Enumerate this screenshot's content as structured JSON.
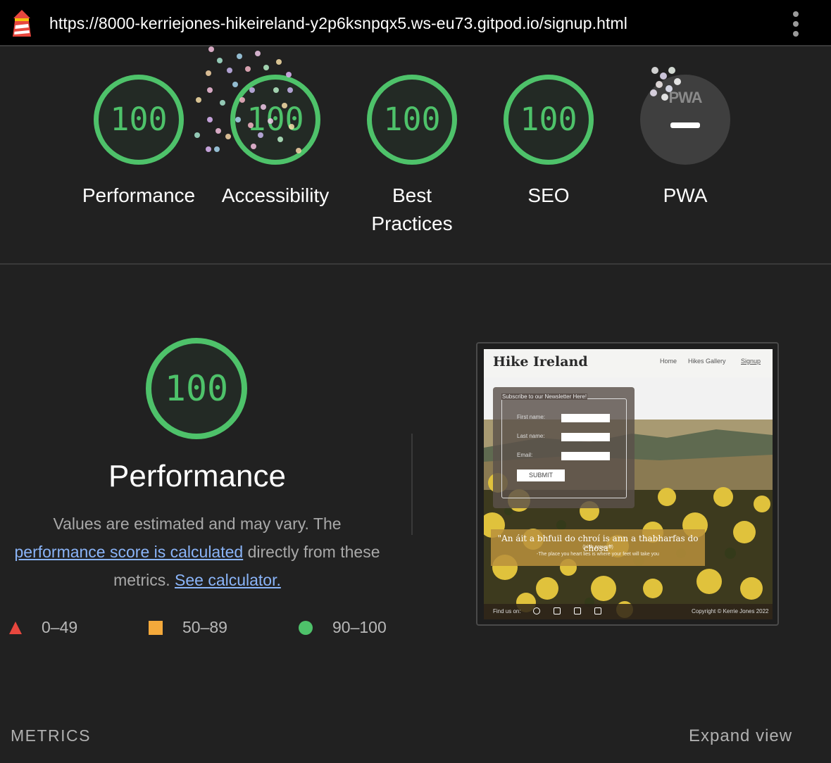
{
  "browser": {
    "url": "https://8000-kerriejones-hikeireland-y2p6ksnpqx5.ws-eu73.gitpod.io/signup.html",
    "logo_icon": "lighthouse-icon",
    "menu_icon": "kebab-menu-icon"
  },
  "categories": [
    {
      "label": "Performance",
      "score": "100"
    },
    {
      "label": "Accessibility",
      "score": "100"
    },
    {
      "label": "Best Practices",
      "score": "100"
    },
    {
      "label": "SEO",
      "score": "100"
    },
    {
      "label": "PWA",
      "score": "",
      "badge": "PWA",
      "icon": "pwa-dash-icon"
    }
  ],
  "performance": {
    "score": "100",
    "title": "Performance",
    "desc_prefix": "Values are estimated and may vary. The",
    "link1": "performance score is calculated",
    "desc_middle": "directly from these metrics.",
    "link2": "See calculator."
  },
  "legend": [
    {
      "range": "0–49",
      "shape": "triangle",
      "color": "#e8473e"
    },
    {
      "range": "50–89",
      "shape": "square",
      "color": "#f4a93b"
    },
    {
      "range": "90–100",
      "shape": "circle",
      "color": "#4ec26a"
    }
  ],
  "colors": {
    "pass": "#4ec26a",
    "link": "#8ab4f8",
    "background": "#212121"
  },
  "thumbnail": {
    "site_title": "Hike Ireland",
    "nav": [
      "Home",
      "Hikes Gallery",
      "Signup"
    ],
    "form_legend": "Subscribe to our Newsletter Here!",
    "fields": [
      "First name:",
      "Last name:",
      "Email:"
    ],
    "submit": "SUBMIT",
    "quote": "\"An áit a bhfuil do chroí is ann a thabharfas do chosa\"",
    "quote_source": "(Irish proverb)",
    "quote_translation": "-The place you heart lies is where your feet will take you",
    "footer_left": "Find us on:",
    "footer_icons": [
      "facebook-icon",
      "twitter-icon",
      "youtube-icon",
      "instagram-icon"
    ],
    "footer_right": "Copyright © Kerrie Jones 2022"
  },
  "metrics_label": "METRICS",
  "expand_label": "Expand view"
}
